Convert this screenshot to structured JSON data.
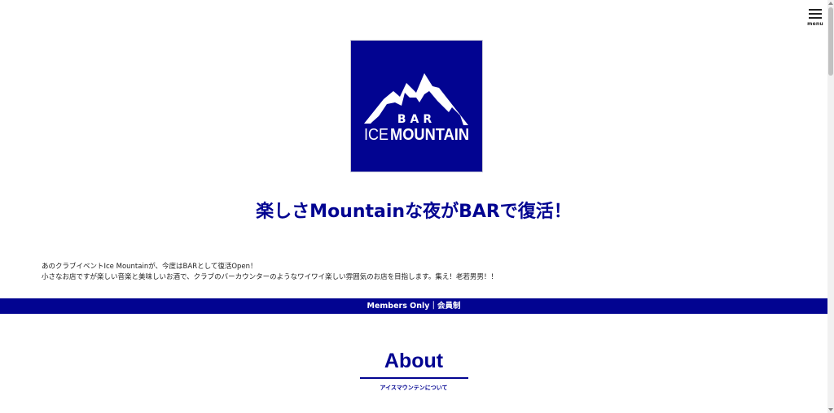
{
  "header": {
    "menu_label": "menu",
    "menu_icon": "hamburger-icon"
  },
  "logo": {
    "top_text": "BAR",
    "main_text_left": "ICE",
    "main_text_right": "MOUNTAIN",
    "background_color": "#020491",
    "icon": "mountain-icon"
  },
  "hero": {
    "headline": "楽しさMountainな夜がBARで復活！"
  },
  "intro": {
    "line1": "あのクラブイベントIce Mountainが、今度はBARとして復活Open！",
    "line2": "小さなお店ですが楽しい音楽と美味しいお酒で、クラブのバーカウンターのようなワイワイ楽しい雰囲気のお店を目指します。集え！老若男男！！"
  },
  "members_bar": {
    "text": "Members Only｜会員制"
  },
  "about": {
    "title": "About",
    "subtitle": "アイスマウンテンについて"
  },
  "colors": {
    "brand_blue": "#020491",
    "text": "#222222",
    "background": "#ffffff"
  }
}
